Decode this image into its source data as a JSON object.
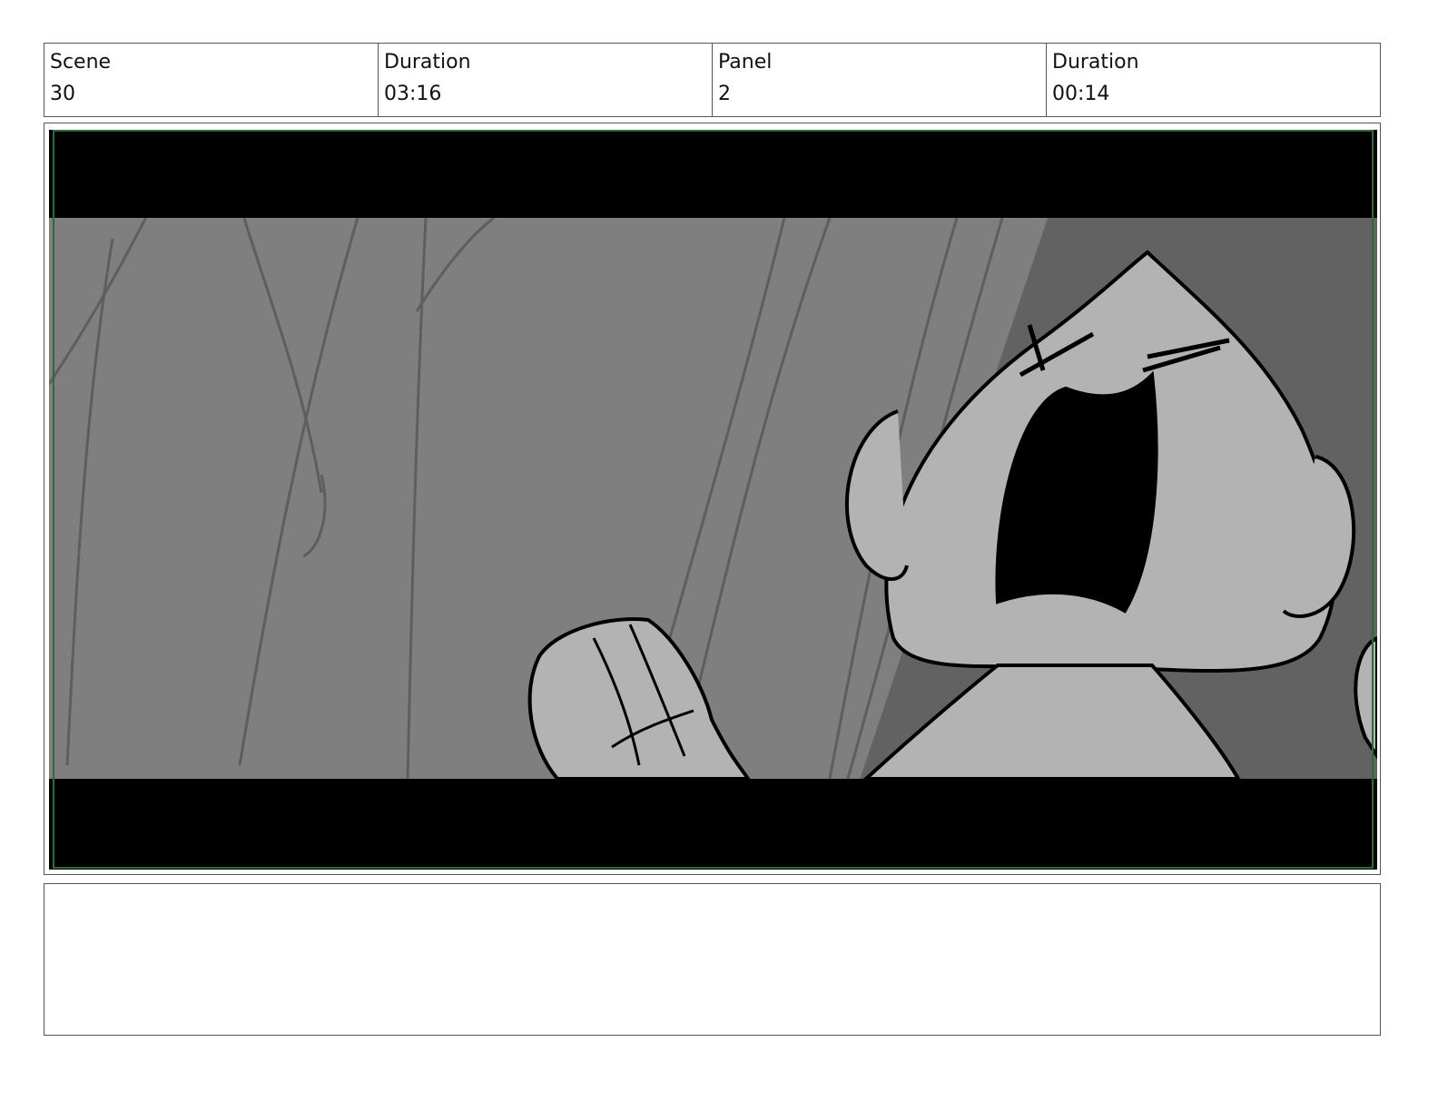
{
  "header": {
    "scene_label": "Scene",
    "scene_value": "30",
    "scene_duration_label": "Duration",
    "scene_duration_value": "03:16",
    "panel_label": "Panel",
    "panel_value": "2",
    "panel_duration_label": "Duration",
    "panel_duration_value": "00:14"
  },
  "notes": {
    "text": ""
  },
  "colors": {
    "letterbox": "#000000",
    "background_gray": "#7f7f7f",
    "shadow_gray": "#626262",
    "character_gray": "#b3b3b3",
    "safe_frame_green": "#2e6b2e"
  }
}
